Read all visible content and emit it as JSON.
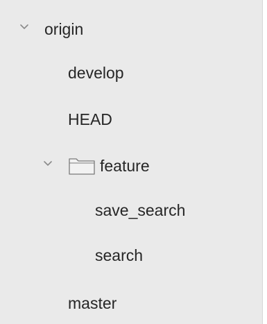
{
  "tree": {
    "origin": {
      "label": "origin",
      "icon": "chevron-down-icon",
      "expanded": true,
      "children": {
        "develop": {
          "label": "develop"
        },
        "head": {
          "label": "HEAD"
        },
        "feature": {
          "label": "feature",
          "icon": "folder-icon",
          "expanded": true,
          "children": {
            "save_search": {
              "label": "save_search"
            },
            "search": {
              "label": "search"
            }
          }
        },
        "master": {
          "label": "master"
        }
      }
    }
  },
  "colors": {
    "background": "#eaeaea",
    "text": "#262626",
    "chevron": "#8a8a8a",
    "folder_stroke": "#7a7a7a"
  }
}
